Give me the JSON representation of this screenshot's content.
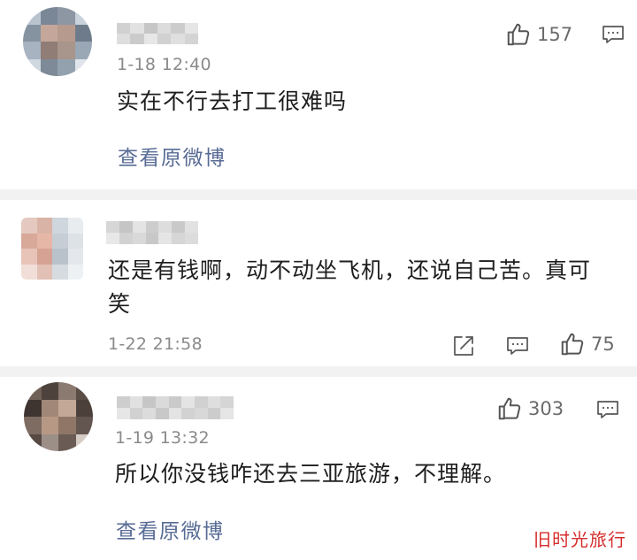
{
  "comments": [
    {
      "time": "1-18 12:40",
      "text": "实在不行去打工很难吗",
      "likes": "157",
      "view_original": "查看原微博"
    },
    {
      "time": "1-22 21:58",
      "text_line1": "还是有钱啊，动不动坐飞机，还说自己苦。真可",
      "text_line2": "笑",
      "likes": "75"
    },
    {
      "time": "1-19 13:32",
      "text": "所以你没钱咋还去三亚旅游，不理解。",
      "likes": "303",
      "view_original": "查看原微博"
    }
  ],
  "icons": {
    "like": "thumbs-up-icon",
    "reply": "comment-bubble-icon",
    "share": "share-icon"
  },
  "colors": {
    "link": "#576b95",
    "time": "#8a8a8a",
    "divider": "#f2f2f2",
    "watermark": "#d62e2e"
  },
  "watermark": "旧时光旅行"
}
